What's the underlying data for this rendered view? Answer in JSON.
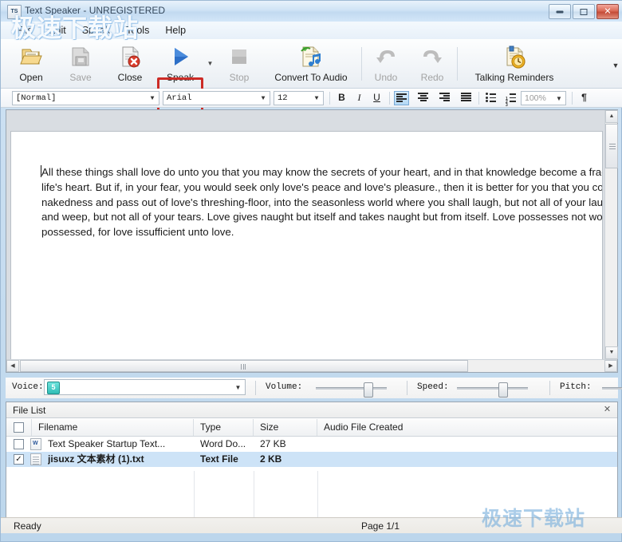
{
  "window": {
    "title": "Text Speaker - UNREGISTERED",
    "icon": "TS",
    "minimize_label": "Minimize",
    "maximize_label": "Maximize",
    "close_label": "✕"
  },
  "menu": {
    "items": [
      {
        "label": "File"
      },
      {
        "label": "Edit"
      },
      {
        "label": "Speak"
      },
      {
        "label": "Tools"
      },
      {
        "label": "Help"
      }
    ]
  },
  "toolbar": {
    "overflow_label": "≡",
    "items": [
      {
        "label": "Open",
        "icon": "open-folder-icon",
        "enabled": true
      },
      {
        "label": "Save",
        "icon": "save-disk-icon",
        "enabled": false
      },
      {
        "label": "Close",
        "icon": "close-document-icon",
        "enabled": true
      },
      {
        "label": "Speak",
        "icon": "play-triangle-icon",
        "enabled": true,
        "highlighted": true
      },
      {
        "label": "Stop",
        "icon": "stop-square-icon",
        "enabled": false
      },
      {
        "label": "Convert To Audio",
        "icon": "convert-audio-icon",
        "enabled": true
      },
      {
        "label": "Undo",
        "icon": "undo-arrow-icon",
        "enabled": false
      },
      {
        "label": "Redo",
        "icon": "redo-arrow-icon",
        "enabled": false
      },
      {
        "label": "Talking Reminders",
        "icon": "reminder-clock-icon",
        "enabled": true
      }
    ]
  },
  "formatbar": {
    "style": "[Normal]",
    "font": "Arial",
    "size": "12",
    "zoom": "100%",
    "bold": "B",
    "italic": "I",
    "underline": "U",
    "pilcrow": "¶"
  },
  "document": {
    "text": "All these things shall love do unto you that you may know the secrets of your heart, and in that knowledge become a fragment of life's heart. But if, in your fear, you would seek only love's peace and love's pleasure., then it is better for you that you cover your nakedness and pass out of love's threshing-floor, into the seasonless world where you shall laugh, but not all of your laughter, and weep, but not all of your tears. Love gives naught but itself and takes naught but from itself. Love possesses not would it be possessed, for love issufficient unto love."
  },
  "voicebar": {
    "voice_label": "Voice:",
    "voice_value": "5",
    "volume_label": "Volume:",
    "speed_label": "Speed:",
    "pitch_label": "Pitch:"
  },
  "filelist": {
    "panel_title": "File List",
    "close_label": "✕",
    "columns": [
      "Filename",
      "Type",
      "Size",
      "Audio File Created"
    ],
    "rows": [
      {
        "checked": false,
        "selected": false,
        "icon": "word-document-icon",
        "filename": "Text Speaker Startup Text...",
        "type": "Word Do...",
        "size": "27 KB",
        "audio_file_created": ""
      },
      {
        "checked": true,
        "selected": true,
        "icon": "text-document-icon",
        "filename": "jisuxz 文本素材 (1).txt",
        "type": "Text File",
        "size": "2 KB",
        "audio_file_created": ""
      }
    ],
    "check_mark": "✓"
  },
  "statusbar": {
    "status": "Ready",
    "page": "Page 1/1"
  },
  "watermark": {
    "top": "极速下载站",
    "bottom": "极速下载站"
  },
  "colors": {
    "highlight_red": "#cc2b26",
    "selection_blue": "#cde3f7",
    "accent_blue": "#2b6fc4"
  }
}
